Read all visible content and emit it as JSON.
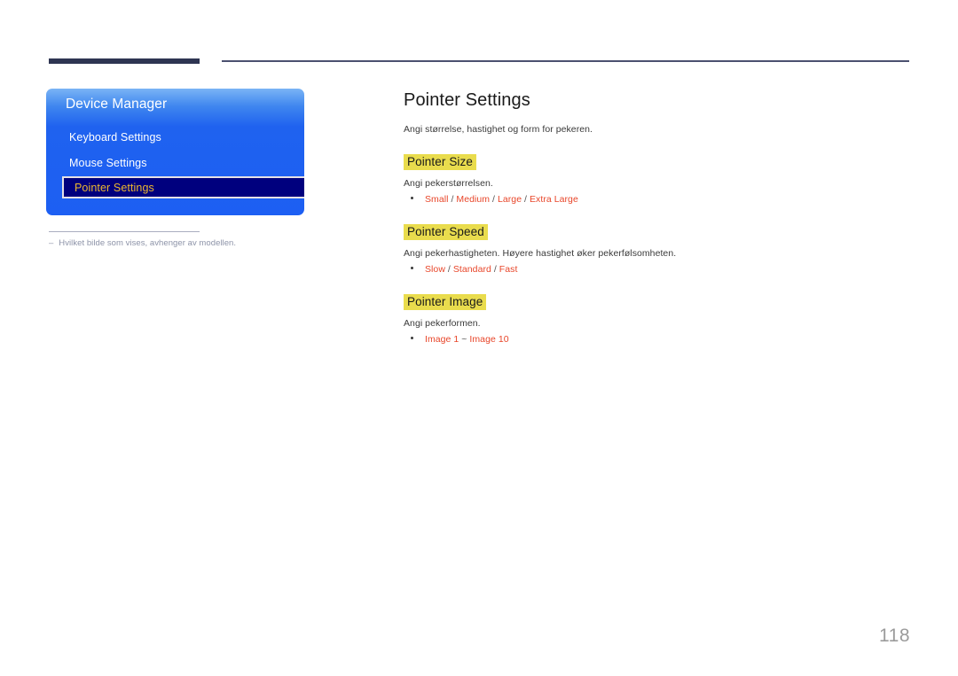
{
  "decor": {
    "top_rule_thick": "#2e3552",
    "top_rule_thin": "#4b5170"
  },
  "osd": {
    "title": "Device Manager",
    "items": [
      {
        "label": "Keyboard Settings",
        "selected": false
      },
      {
        "label": "Mouse Settings",
        "selected": false
      },
      {
        "label": "Pointer Settings",
        "selected": true
      }
    ],
    "panel_color": "#1f62ef",
    "selected_bg": "#00007e",
    "selected_text_color": "#edb72f"
  },
  "footnote": {
    "dash": "‒",
    "text": "Hvilket bilde som vises, avhenger av modellen."
  },
  "content": {
    "title": "Pointer Settings",
    "intro": "Angi størrelse, hastighet og form for pekeren.",
    "highlight_color": "#e9dc4d",
    "option_color": "#e8462a",
    "sections": [
      {
        "heading": "Pointer Size",
        "description": "Angi pekerstørrelsen.",
        "options": [
          "Small",
          "Medium",
          "Large",
          "Extra Large"
        ],
        "separator": " / "
      },
      {
        "heading": "Pointer Speed",
        "description": "Angi pekerhastigheten. Høyere hastighet øker pekerfølsomheten.",
        "options": [
          "Slow",
          "Standard",
          "Fast"
        ],
        "separator": " / "
      },
      {
        "heading": "Pointer Image",
        "description": "Angi pekerformen.",
        "options": [
          "Image 1",
          "Image 10"
        ],
        "separator": " ~ "
      }
    ]
  },
  "page_number": "118"
}
